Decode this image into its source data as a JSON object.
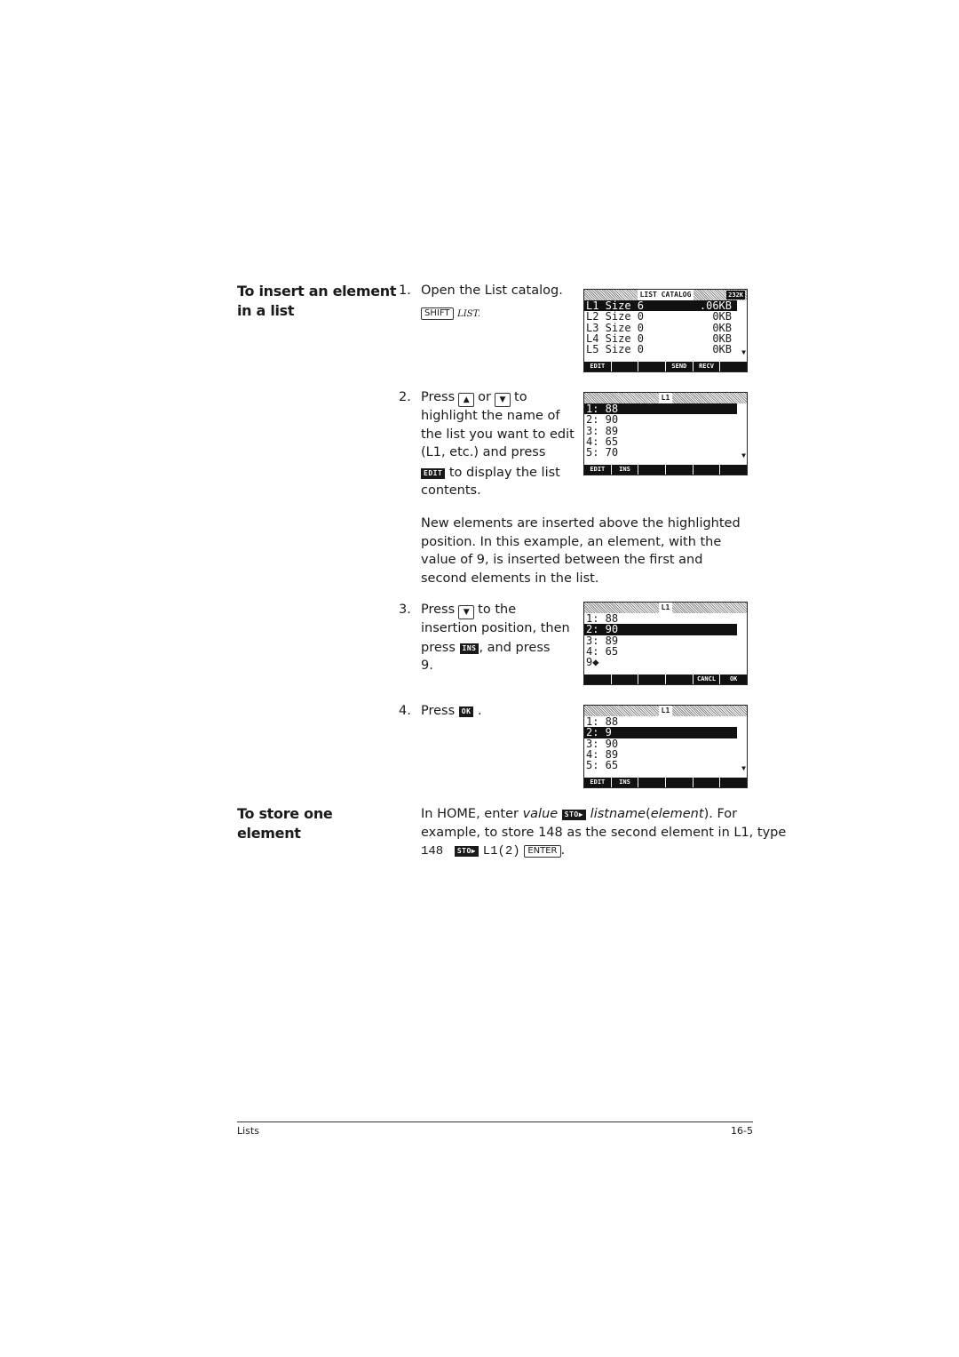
{
  "sections": {
    "insert": {
      "heading_line1": "To insert an element",
      "heading_line2": "in a list"
    },
    "store": {
      "heading_line1": "To store one",
      "heading_line2": "element"
    }
  },
  "steps": [
    {
      "num": "1.",
      "text": "Open the List catalog.",
      "key_shift": "SHIFT",
      "key_list": "LIST",
      "suffix": "."
    },
    {
      "num": "2.",
      "press": "Press",
      "or": "or",
      "to": "to",
      "up_icon": "▲",
      "down_icon": "▼",
      "line2": "highlight the name of",
      "line3": "the list you want to edit",
      "line4": "(L1, etc.) and press",
      "soft_key": "EDIT",
      "line5_rest": "to display the list",
      "line6": "contents."
    },
    {
      "num": "3.",
      "press": "Press",
      "down_icon": "▼",
      "to_the": "to the",
      "line2": "insertion position, then",
      "press2": "press",
      "soft_key": "INS",
      "line3_rest": ", and press",
      "line4": "9."
    },
    {
      "num": "4.",
      "press": "Press",
      "soft_key": "OK",
      "suffix": "."
    }
  ],
  "paragraph_inserted": "New elements are inserted above the highlighted position. In this example, an element, with the value of 9, is inserted between the first and second elements in the list.",
  "store_text": {
    "part1": "In HOME, enter ",
    "value_word": "value",
    "sto_key": "STO▶",
    "listname_word": "listname",
    "paren_open": "(",
    "element_word": "element",
    "part2": "). For",
    "line2": "example, to store 148 as the second element in L1, type",
    "code_148": "148",
    "code_l1": "L1(2)",
    "enter_key": "ENTER",
    "end": "."
  },
  "screens": [
    {
      "title": "LIST CATALOG",
      "memory": "232K",
      "rows": [
        {
          "left": "L1 Size 6",
          "right": ".06KB",
          "highlighted": true
        },
        {
          "left": "L2 Size 0",
          "right": "0KB",
          "highlighted": false
        },
        {
          "left": "L3 Size 0",
          "right": "0KB",
          "highlighted": false
        },
        {
          "left": "L4 Size 0",
          "right": "0KB",
          "highlighted": false
        },
        {
          "left": "L5 Size 0",
          "right": "0KB",
          "highlighted": false
        }
      ],
      "more_arrow": "▼",
      "menu": [
        "EDIT",
        "",
        "",
        "SEND",
        "RECV",
        ""
      ]
    },
    {
      "title": "L1",
      "rows": [
        {
          "left": "1: 88",
          "highlighted": true
        },
        {
          "left": "2: 90",
          "highlighted": false
        },
        {
          "left": "3: 89",
          "highlighted": false
        },
        {
          "left": "4: 65",
          "highlighted": false
        },
        {
          "left": "5: 70",
          "highlighted": false
        }
      ],
      "more_arrow": "▼",
      "menu": [
        "EDIT",
        "INS",
        "",
        "",
        "",
        ""
      ]
    },
    {
      "title": "L1",
      "rows": [
        {
          "left": "1: 88",
          "highlighted": false
        },
        {
          "left": "2: 90",
          "highlighted": true
        },
        {
          "left": "3: 89",
          "highlighted": false
        },
        {
          "left": "4: 65",
          "highlighted": false
        },
        {
          "left": "9◆",
          "highlighted": false
        }
      ],
      "more_arrow": "",
      "menu": [
        "",
        "",
        "",
        "",
        "CANCL",
        "OK"
      ]
    },
    {
      "title": "L1",
      "rows": [
        {
          "left": "1: 88",
          "highlighted": false
        },
        {
          "left": "2: 9",
          "highlighted": true
        },
        {
          "left": "3: 90",
          "highlighted": false
        },
        {
          "left": "4: 89",
          "highlighted": false
        },
        {
          "left": "5: 65",
          "highlighted": false
        }
      ],
      "more_arrow": "▼",
      "menu": [
        "EDIT",
        "INS",
        "",
        "",
        "",
        ""
      ]
    }
  ],
  "footer": {
    "left": "Lists",
    "right": "16-5"
  }
}
